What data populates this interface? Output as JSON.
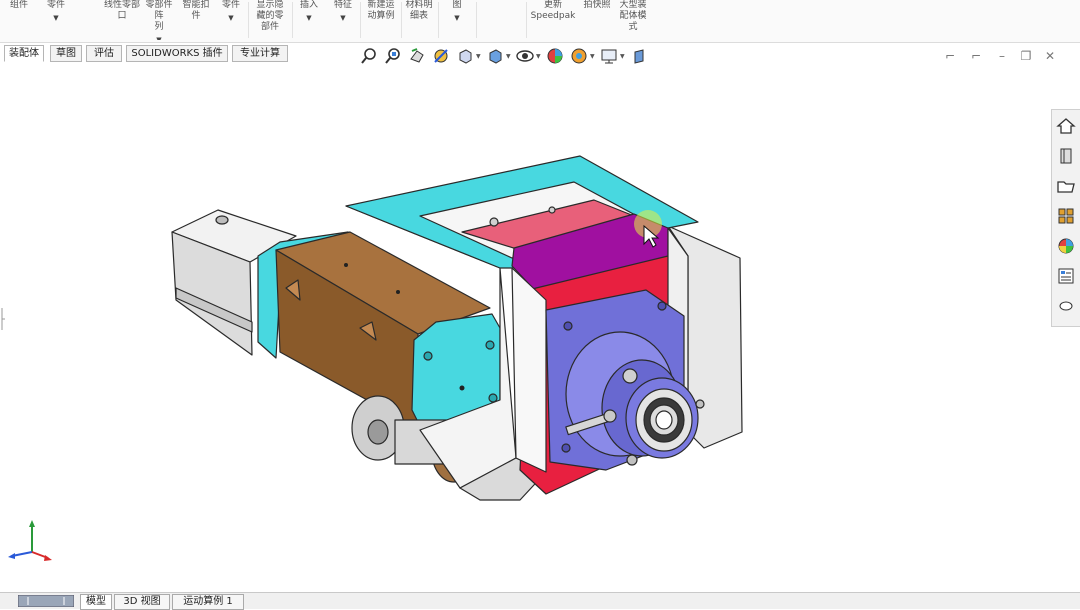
{
  "ribbon": {
    "groups": [
      {
        "line1": "组件",
        "line2": "",
        "line3": ""
      },
      {
        "line1": "零件",
        "line2": "",
        "line3": ""
      },
      {
        "line1": "",
        "line2": "",
        "line3": ""
      },
      {
        "line1": "",
        "line2": "线性零部",
        "line3": "口"
      },
      {
        "line1": "零部件阵",
        "line2": "列",
        "line3": ""
      },
      {
        "line1": "智能扣",
        "line2": "件",
        "line3": ""
      },
      {
        "line1": "零件",
        "line2": "",
        "line3": ""
      },
      {
        "line1": "显示隐",
        "line2": "藏的零",
        "line3": "部件"
      },
      {
        "line1": "插入",
        "line2": "",
        "line3": ""
      },
      {
        "line1": "特征",
        "line2": "",
        "line3": ""
      },
      {
        "line1": "新建运",
        "line2": "动算例",
        "line3": ""
      },
      {
        "line1": "材料明",
        "line2": "细表",
        "line3": ""
      },
      {
        "line1": "图",
        "line2": "",
        "line3": ""
      },
      {
        "line1": "",
        "line2": "",
        "line3": ""
      },
      {
        "line1": "更新",
        "line2": "Speedpak",
        "line3": ""
      },
      {
        "line1": "拍快照",
        "line2": "",
        "line3": ""
      },
      {
        "line1": "大型装",
        "line2": "配体模",
        "line3": "式"
      }
    ]
  },
  "tabs": [
    "装配体",
    "草图",
    "评估",
    "SOLIDWORKS 插件",
    "专业计算"
  ],
  "active_tab": 0,
  "view_toolbar": {
    "icons": [
      "zoom-to-fit",
      "zoom-to-area",
      "previous-view",
      "section-view",
      "view-orientation",
      "display-style",
      "hide-show-items",
      "edit-appearance",
      "apply-scene",
      "view-settings",
      "display-pane"
    ]
  },
  "task_pane": {
    "icons": [
      "home",
      "design-library",
      "file-explorer",
      "view-palette",
      "appearances",
      "custom-properties",
      "forum"
    ]
  },
  "bottom_tabs": [
    "模型",
    "3D 视图",
    "运动算例 1"
  ],
  "colors": {
    "accent_cyan": "#48d8e0",
    "housing_gray": "#e6e6e6",
    "motor_brown": "#8a5a2a",
    "flange_blue": "#7070d8",
    "red_block": "#e82040",
    "magenta_block": "#a010a0",
    "pink_block": "#e8607a"
  }
}
